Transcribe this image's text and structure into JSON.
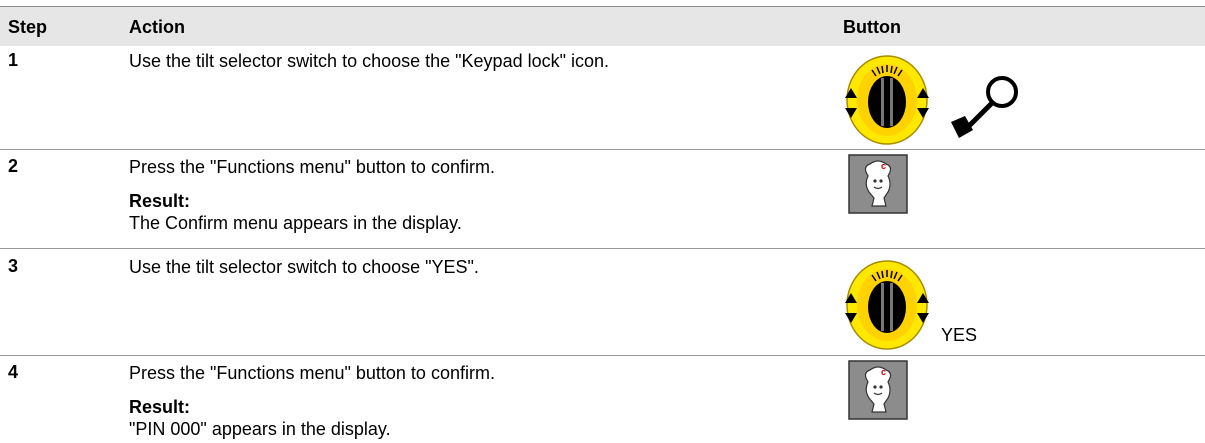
{
  "table": {
    "headers": {
      "step": "Step",
      "action": "Action",
      "button": "Button"
    },
    "rows": [
      {
        "step": "1",
        "action": "Use the tilt selector switch to choose the \"Keypad lock\" icon.",
        "result_label": "",
        "result_text": "",
        "button_icons": [
          "tilt-selector-switch-icon",
          "key-icon"
        ],
        "button_text": ""
      },
      {
        "step": "2",
        "action": "Press the \"Functions menu\" button to confirm.",
        "result_label": "Result:",
        "result_text": "The Confirm menu appears in the display.",
        "button_icons": [
          "functions-menu-button-icon"
        ],
        "button_text": ""
      },
      {
        "step": "3",
        "action": "Use the tilt selector switch to choose \"YES\".",
        "result_label": "",
        "result_text": "",
        "button_icons": [
          "tilt-selector-switch-icon"
        ],
        "button_text": "YES"
      },
      {
        "step": "4",
        "action": "Press the \"Functions menu\" button to confirm.",
        "result_label": "Result:",
        "result_text": "\"PIN 000\" appears in the display.",
        "button_icons": [
          "functions-menu-button-icon"
        ],
        "button_text": ""
      }
    ]
  },
  "colors": {
    "header_bg": "#e6e6e6",
    "dial_yellow": "#ffe800",
    "button_gray": "#8c8c8c"
  }
}
